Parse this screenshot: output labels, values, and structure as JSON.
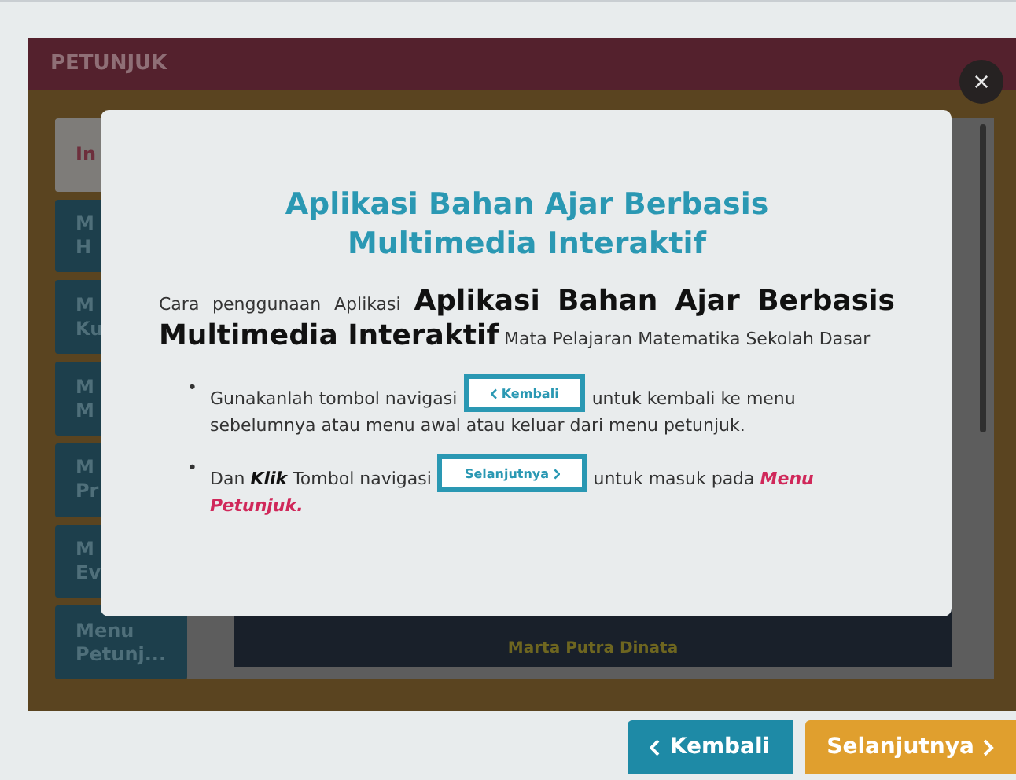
{
  "window": {
    "title": "PETUNJUK",
    "close_label": "×"
  },
  "sidebar": {
    "items": [
      {
        "lines": [
          "In"
        ],
        "selected": true
      },
      {
        "lines": [
          "M",
          "H"
        ],
        "selected": false
      },
      {
        "lines": [
          "M",
          "Ku"
        ],
        "selected": false
      },
      {
        "lines": [
          "M",
          "M"
        ],
        "selected": false
      },
      {
        "lines": [
          "M",
          "Pr"
        ],
        "selected": false
      },
      {
        "lines": [
          "M",
          "Ev"
        ],
        "selected": false
      },
      {
        "lines": [
          "Menu",
          "Petunj..."
        ],
        "selected": false
      }
    ]
  },
  "content": {
    "author": "Marta Putra Dinata"
  },
  "modal": {
    "title": "Aplikasi Bahan Ajar Berbasis Multimedia Interaktif",
    "intro": "Cara penggunaan Aplikasi **Aplikasi Bahan Ajar Berbasis Multimedia Interaktif** Mata Pelajaran Matematika Sekolah Dasar",
    "bullets": [
      {
        "marker": "•",
        "before": "Gunakanlah tombol navigasi",
        "button": {
          "kind": "back",
          "label": "Kembali"
        },
        "after": "untuk kembali ke menu sebelumnya atau menu awal atau keluar dari menu petunjuk."
      },
      {
        "marker": "•",
        "before": "Dan **Klik** Tombol navigasi",
        "button": {
          "kind": "next",
          "label": "Selanjutnya"
        },
        "after": "untuk masuk pada *Menu Petunjuk.*"
      }
    ]
  },
  "footer": {
    "buttons": [
      {
        "kind": "back",
        "label": "Kembali"
      },
      {
        "kind": "next",
        "label": "Selanjutnya"
      }
    ]
  }
}
